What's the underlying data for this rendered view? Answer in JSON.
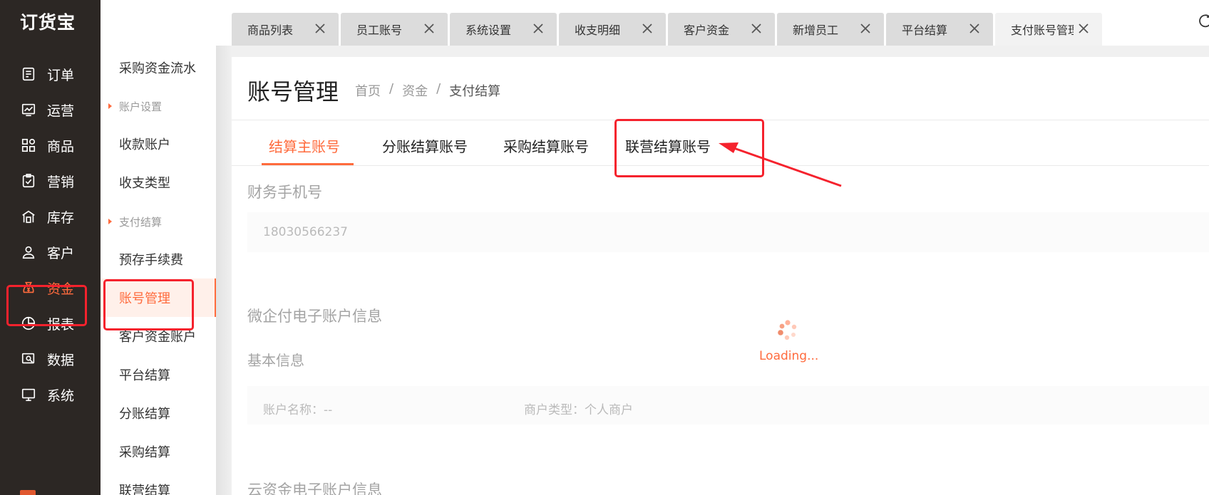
{
  "app": {
    "logo": "订货宝"
  },
  "nav": {
    "items": [
      {
        "label": "订单",
        "icon": "order-icon"
      },
      {
        "label": "运营",
        "icon": "operation-chart-icon"
      },
      {
        "label": "商品",
        "icon": "product-grid-icon"
      },
      {
        "label": "营销",
        "icon": "marketing-badge-icon"
      },
      {
        "label": "库存",
        "icon": "warehouse-icon"
      },
      {
        "label": "客户",
        "icon": "user-icon"
      },
      {
        "label": "资金",
        "icon": "money-bag-icon"
      },
      {
        "label": "报表",
        "icon": "pie-chart-icon"
      },
      {
        "label": "数据",
        "icon": "data-search-icon"
      },
      {
        "label": "系统",
        "icon": "monitor-icon"
      }
    ],
    "active": "资金"
  },
  "submenu": {
    "item_top": "采购资金流水",
    "group_account": "账户设置",
    "item_receive": "收款账户",
    "item_income_type": "收支类型",
    "group_pay": "支付结算",
    "item_prepay_fee": "预存手续费",
    "item_account_mgmt": "账号管理",
    "item_customer_fund": "客户资金账户",
    "item_platform": "平台结算",
    "item_split": "分账结算",
    "item_purchase": "采购结算",
    "item_joint": "联营结算"
  },
  "tabs": [
    {
      "label": "商品列表"
    },
    {
      "label": "员工账号"
    },
    {
      "label": "系统设置"
    },
    {
      "label": "收支明细"
    },
    {
      "label": "客户资金"
    },
    {
      "label": "新增员工"
    },
    {
      "label": "平台结算"
    },
    {
      "label": "支付账号管理"
    }
  ],
  "page": {
    "title": "账号管理",
    "breadcrumb": {
      "home": "首页",
      "sep1": "/",
      "fund": "资金",
      "sep2": "/",
      "current": "支付结算"
    }
  },
  "content_tabs": {
    "main": "结算主账号",
    "split": "分账结算账号",
    "purchase": "采购结算账号",
    "joint": "联营结算账号"
  },
  "form": {
    "phone_label": "财务手机号",
    "phone_value": "18030566237",
    "weiqifu_title": "微企付电子账户信息",
    "basic_info": "基本信息",
    "account_name": "账户名称：--",
    "merchant_type": "商户类型：个人商户",
    "cloud_title": "云资金电子账户信息"
  },
  "loading": {
    "text": "Loading..."
  },
  "colors": {
    "accent": "#ff6b3d",
    "annotation": "#f5222d",
    "nav_bg": "#2c2724"
  }
}
